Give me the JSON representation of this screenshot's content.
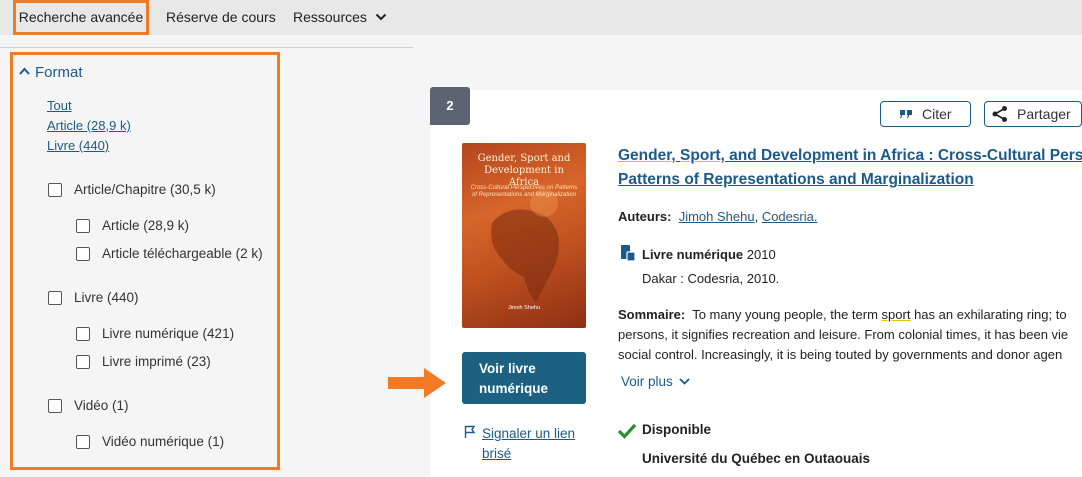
{
  "topbar": {
    "advanced_search": "Recherche avancée",
    "course_reserve": "Réserve de cours",
    "resources": "Ressources"
  },
  "facet": {
    "title": "Format",
    "links": [
      "Tout",
      "Article (28,9 k)",
      "Livre (440)"
    ],
    "options": [
      {
        "label": "Article/Chapitre (30,5 k)",
        "checked": false
      },
      {
        "label": "Article (28,9 k)",
        "checked": false
      },
      {
        "label": "Article téléchargeable (2 k)",
        "checked": false
      },
      {
        "label": "Livre (440)",
        "checked": false
      },
      {
        "label": "Livre numérique (421)",
        "checked": false
      },
      {
        "label": "Livre imprimé (23)",
        "checked": false
      },
      {
        "label": "Vidéo (1)",
        "checked": false
      },
      {
        "label": "Vidéo numérique (1)",
        "checked": false
      }
    ]
  },
  "result": {
    "number": "2",
    "cite_label": "Citer",
    "share_label": "Partager",
    "cover": {
      "title": "Gender, Sport and Development in Africa",
      "subtitle": "Cross-Cultural Perspectives on Patterns of Representations and Marginalization",
      "author": "Jimoh Shehu"
    },
    "title_parts": [
      "Gender",
      ", ",
      "Sport",
      ", and Development in Africa : Cross-Cultural Perspe"
    ],
    "title_line2": "Patterns of Representations and Marginalization",
    "authors_label": "Auteurs:",
    "authors": [
      "Jimoh Shehu",
      "Codesria."
    ],
    "format_label": "Livre numérique",
    "year": "2010",
    "publisher": "Dakar : Codesria, 2010.",
    "summary_label": "Sommaire:",
    "summary_lines": [
      "To many young people, the term ",
      "sport",
      " has an exhilarating ring; to",
      "persons, it signifies recreation and leisure. From colonial times, it has been vie",
      "social control. Increasingly, it is being touted by governments and donor agen"
    ],
    "see_more": "Voir plus",
    "view_button": "Voir livre numérique",
    "report_link": "Signaler un lien brisé",
    "availability": "Disponible",
    "library": "Université du Québec en Outaouais"
  },
  "colors": {
    "highlight_orange": "#f27a25",
    "link_blue": "#1c5a8a",
    "button_blue": "#1c6082",
    "available_green": "#2e8b2e"
  }
}
